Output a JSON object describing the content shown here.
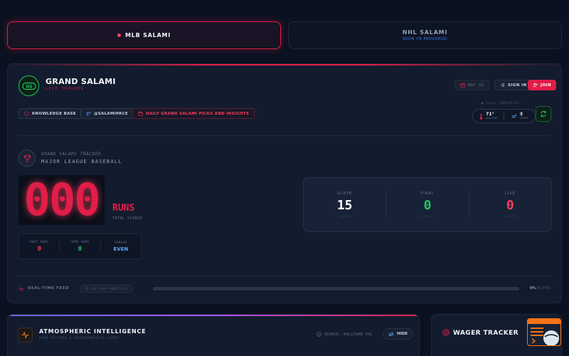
{
  "tabs": [
    {
      "label": "MLB SALAMI",
      "sub": "",
      "active": true
    },
    {
      "label": "NHL SALAMI",
      "sub": "SOON (IN PROGRESS)",
      "active": false
    }
  ],
  "header": {
    "title": "GRAND SALAMI",
    "subtitle": "LIVE TRACKER",
    "date": "MAY 31",
    "sign_in": "SIGN IN",
    "join": "JOIN"
  },
  "links": {
    "knowledge_base": "KNOWLEDGE BASE",
    "twitter": "@SALAMIPACE",
    "daily": "DAILY GRAND SALAMI PICKS AND INSIGHTS"
  },
  "weather": {
    "coords": "● Ca1ic 38N97Ex41",
    "temp": "71°",
    "temp_label": "AVG TMP",
    "wind": "3",
    "wind_label": "SPEED"
  },
  "section": {
    "kicker": "GRAND SALAMI TRACKER",
    "title": "MAJOR LEAGUE BASEBALL"
  },
  "score": {
    "total": "000",
    "runs_label": "RUNS",
    "total_label": "TOTAL SCORED",
    "away_label": "AWAY RUNS",
    "away_value": "0",
    "home_label": "HOME RUNS",
    "home_value": "0",
    "spread_label": "SPREAD",
    "spread_value": "EVEN"
  },
  "slate": [
    {
      "label": "SLATE",
      "value": "15",
      "foot": "GAMES"
    },
    {
      "label": "FINAL",
      "value": "0",
      "foot": "COMPLETE"
    },
    {
      "label": "LIVE",
      "value": "0",
      "foot": "IN PLAY"
    }
  ],
  "feed": {
    "label": "REAL-TIME FEED",
    "chip": "LESS THAN A MINUTE AGO",
    "progress": 0,
    "pct": "0%",
    "pct_suffix": "PLAYED"
  },
  "atmospheric": {
    "title": "ATMOSPHERIC INTELLIGENCE",
    "subtitle": "PARK FACTORS & ENVIRONMENTAL CARRY",
    "source": "SOURCE: BALLPARK PAL",
    "hide": "HIDE"
  },
  "wager": {
    "title": "WAGER TRACKER"
  },
  "colors": {
    "accent": "#e11d48",
    "success": "#22c55e",
    "info": "#60a5fa",
    "background": "#0b1120",
    "panel": "#131c2e"
  }
}
